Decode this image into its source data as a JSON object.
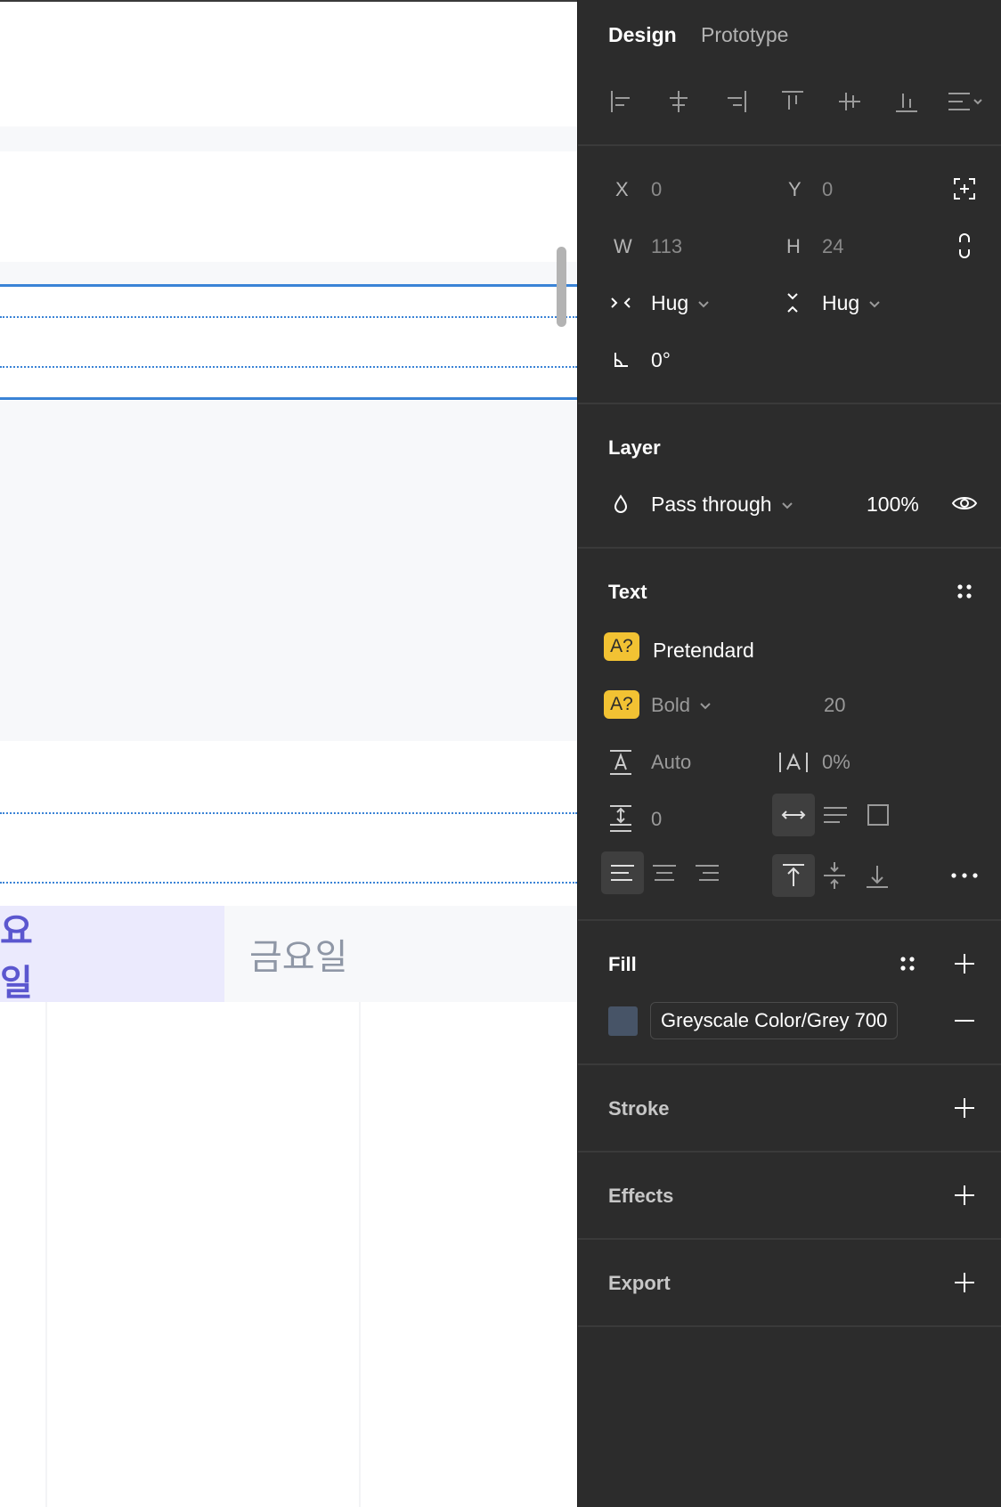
{
  "canvas": {
    "days": [
      "요일",
      "금요일"
    ]
  },
  "tabs": {
    "design": "Design",
    "prototype": "Prototype"
  },
  "position": {
    "x_label": "X",
    "x_value": "0",
    "y_label": "Y",
    "y_value": "0",
    "w_label": "W",
    "w_value": "113",
    "h_label": "H",
    "h_value": "24",
    "width_mode": "Hug",
    "height_mode": "Hug",
    "rotation": "0°"
  },
  "layer": {
    "title": "Layer",
    "blend_mode": "Pass through",
    "opacity": "100%"
  },
  "text": {
    "title": "Text",
    "badge": "A?",
    "font_family": "Pretendard",
    "font_weight": "Bold",
    "font_size": "20",
    "line_height": "Auto",
    "letter_spacing": "0%",
    "paragraph_spacing": "0"
  },
  "fill": {
    "title": "Fill",
    "style_name": "Greyscale Color/Grey 700",
    "color": "#475467"
  },
  "stroke": {
    "title": "Stroke"
  },
  "effects": {
    "title": "Effects"
  },
  "export": {
    "title": "Export"
  },
  "colors": {
    "accent": "#3a83d6",
    "badge": "#f2c233",
    "panel": "#2c2c2c",
    "day_active": "#5b57cf"
  }
}
